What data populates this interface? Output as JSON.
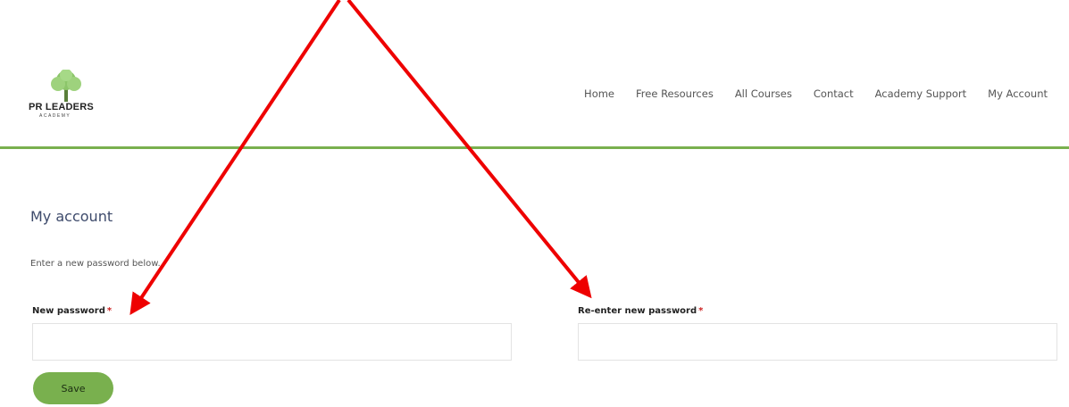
{
  "header": {
    "logo": {
      "text": "PR LEADERS",
      "subtext": "ACADEMY",
      "icon": "tree-icon"
    },
    "nav": [
      {
        "label": "Home"
      },
      {
        "label": "Free Resources"
      },
      {
        "label": "All Courses"
      },
      {
        "label": "Contact"
      },
      {
        "label": "Academy Support"
      },
      {
        "label": "My Account"
      }
    ]
  },
  "main": {
    "title": "My account",
    "intro": "Enter a new password below.",
    "fields": {
      "new_password": {
        "label": "New password",
        "required_mark": "*",
        "value": "",
        "placeholder": ""
      },
      "confirm_password": {
        "label": "Re-enter new password",
        "required_mark": "*",
        "value": "",
        "placeholder": ""
      }
    },
    "save_label": "Save"
  },
  "colors": {
    "accent_green": "#79b04e",
    "title_navy": "#3d4a6b",
    "annotation_red": "#ee0000",
    "required_red": "#cc2222"
  }
}
